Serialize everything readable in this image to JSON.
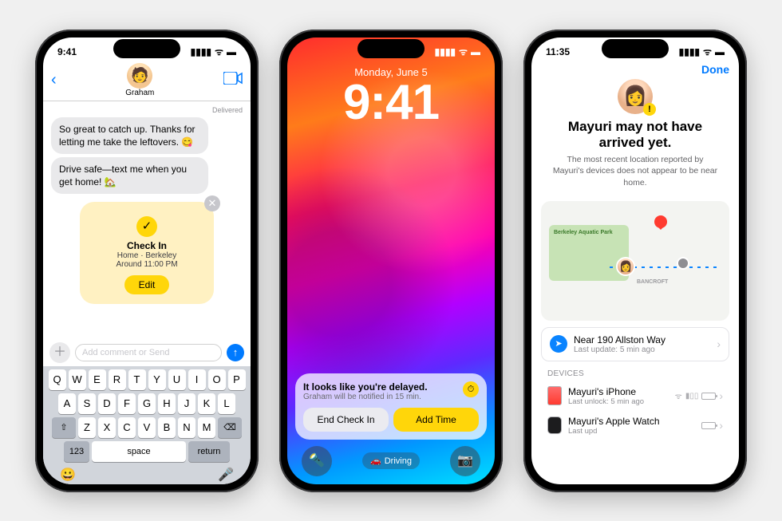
{
  "phone1": {
    "status_time": "9:41",
    "back_glyph": "‹",
    "contact_name": "Graham",
    "facetime_icon": "⎚",
    "delivered_label": "Delivered",
    "msg1": "So great to catch up. Thanks for letting me take the leftovers. 😋",
    "msg2": "Drive safe—text me when you get home! 🏡",
    "checkin": {
      "close_glyph": "✕",
      "badge_glyph": "✓",
      "title": "Check In",
      "line1": "Home · Berkeley",
      "line2": "Around 11:00 PM",
      "edit_label": "Edit"
    },
    "plus_glyph": "＋",
    "compose_placeholder": "Add comment or Send",
    "send_glyph": "↑",
    "keyboard": {
      "rows": [
        [
          "Q",
          "W",
          "E",
          "R",
          "T",
          "Y",
          "U",
          "I",
          "O",
          "P"
        ],
        [
          "A",
          "S",
          "D",
          "F",
          "G",
          "H",
          "J",
          "K",
          "L"
        ],
        [
          "Z",
          "X",
          "C",
          "V",
          "B",
          "N",
          "M"
        ]
      ],
      "shift": "⇧",
      "backspace": "⌫",
      "numbers": "123",
      "space": "space",
      "return": "return",
      "emoji": "😀",
      "mic": "🎤"
    }
  },
  "phone2": {
    "date": "Monday, June 5",
    "time": "9:41",
    "delay": {
      "title": "It looks like you're delayed.",
      "sub": "Graham will be notified in 15 min.",
      "icon_glyph": "⏱",
      "end_label": "End Check In",
      "add_label": "Add Time"
    },
    "flashlight_glyph": "🔦",
    "focus_icon": "🚗",
    "focus_label": "Driving",
    "camera_glyph": "📷"
  },
  "phone3": {
    "status_time": "11:35",
    "done_label": "Done",
    "title": "Mayuri may not have arrived yet.",
    "sub": "The most recent location reported by Mayuri's devices does not appear to be near home.",
    "map": {
      "park_label": "Berkeley Aquatic Park",
      "street_label": "BANCROFT"
    },
    "location": {
      "icon_glyph": "➤",
      "title": "Near 190 Allston Way",
      "sub": "Last update: 5 min ago",
      "chev": "›"
    },
    "devices_header": "DEVICES",
    "dev1": {
      "title": "Mayuri's iPhone",
      "sub": "Last unlock: 5 min ago",
      "wifi": "ᯤ",
      "sig": "▮▯▯"
    },
    "dev2": {
      "title": "Mayuri's Apple Watch",
      "sub": "Last upd"
    }
  }
}
